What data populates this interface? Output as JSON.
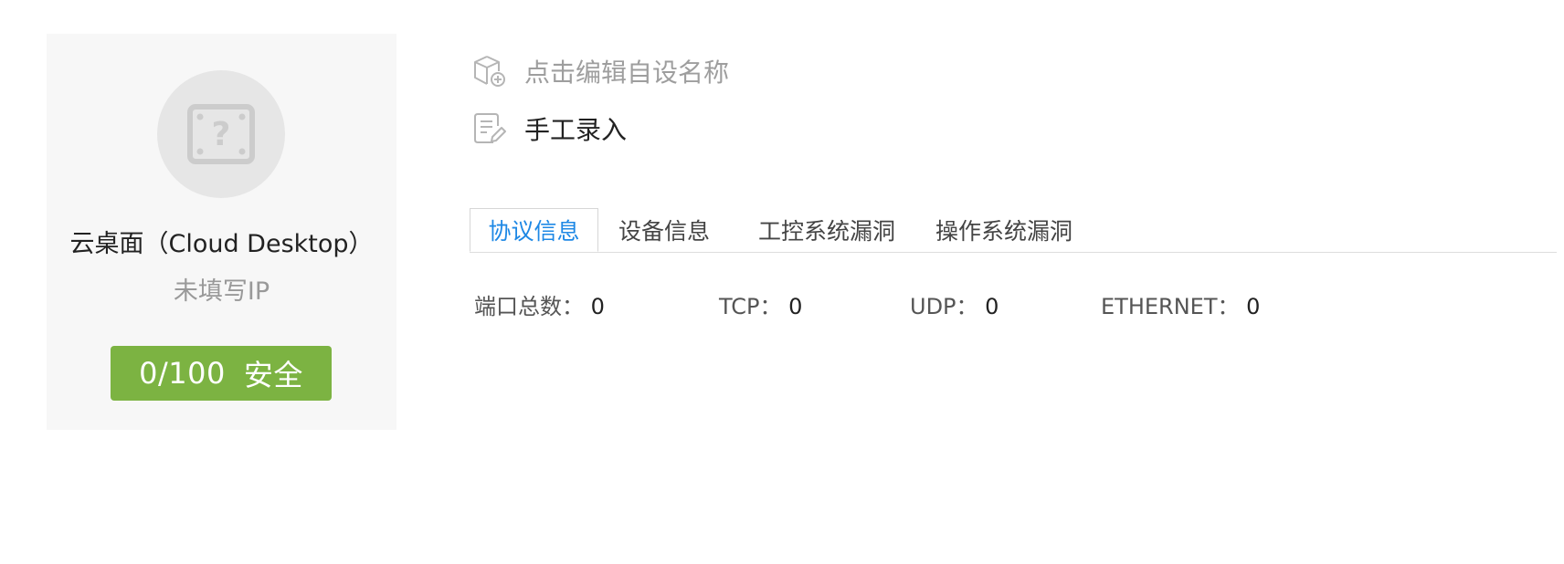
{
  "device": {
    "icon": "unknown-device-icon",
    "name": "云桌面（Cloud Desktop）",
    "ip": "未填写IP",
    "score": "0/100",
    "status": "安全",
    "status_color": "#7cb342"
  },
  "details": {
    "custom_name": {
      "icon": "cube-add-icon",
      "text": "点击编辑自设名称"
    },
    "source": {
      "icon": "edit-document-icon",
      "text": "手工录入"
    }
  },
  "tabs": [
    {
      "label": "协议信息",
      "active": true
    },
    {
      "label": "设备信息",
      "active": false
    },
    {
      "label": "工控系统漏洞",
      "active": false
    },
    {
      "label": "操作系统漏洞",
      "active": false
    }
  ],
  "accent_color": "#1e88e5",
  "stats": [
    {
      "label": "端口总数：",
      "value": "0"
    },
    {
      "label": "TCP：",
      "value": "0"
    },
    {
      "label": "UDP：",
      "value": "0"
    },
    {
      "label": "ETHERNET：",
      "value": "0"
    }
  ]
}
